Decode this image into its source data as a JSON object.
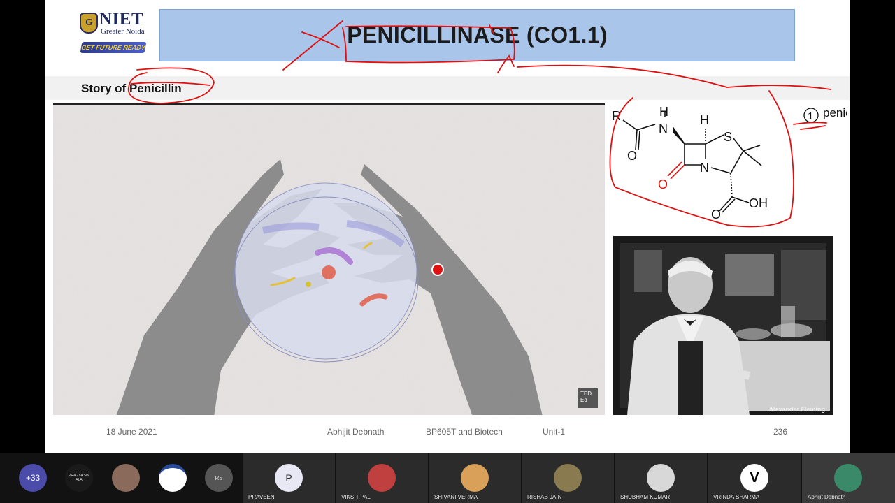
{
  "slide": {
    "logo": {
      "name": "NIET",
      "sub": "Greater Noida",
      "tagline": "GET FUTURE READY"
    },
    "title": "PENICILLINASE (CO1.1)",
    "subtitle": "Story of Penicillin",
    "video_badge": "TED Ed",
    "structure_labels": {
      "r": "R",
      "h1": "H",
      "n1": "N",
      "h2": "H",
      "s": "S",
      "o1": "O",
      "o2": "O",
      "n2": "N",
      "o3": "O",
      "oh": "OH"
    },
    "annotation": {
      "number": "1",
      "text": "penicillins"
    },
    "photo_caption": "Alexander Fleming",
    "footer": {
      "date": "18 June 2021",
      "author": "Abhijit Debnath",
      "course": "BP605T and Biotech",
      "unit": "Unit-1",
      "page": "236"
    }
  },
  "participants": {
    "more_count": "+33",
    "initials_small": [
      "PRAGYA SIN ALA",
      "RS"
    ],
    "tiles": [
      {
        "name": "PRAVEEN",
        "avatar": "P"
      },
      {
        "name": "VIKSIT PAL",
        "avatar": ""
      },
      {
        "name": "SHIVANI VERMA",
        "avatar": ""
      },
      {
        "name": "RISHAB JAIN",
        "avatar": ""
      },
      {
        "name": "SHUBHAM KUMAR",
        "avatar": ""
      },
      {
        "name": "VRINDA SHARMA",
        "avatar": ""
      },
      {
        "name": "Abhijit Debnath",
        "avatar": ""
      }
    ],
    "colors": {
      "strip": "#121212",
      "tile": "#2b2b2b",
      "active": "#3a3a3a"
    }
  },
  "colors": {
    "title_bg": "#a9c6ea",
    "ink": "#e01010"
  }
}
